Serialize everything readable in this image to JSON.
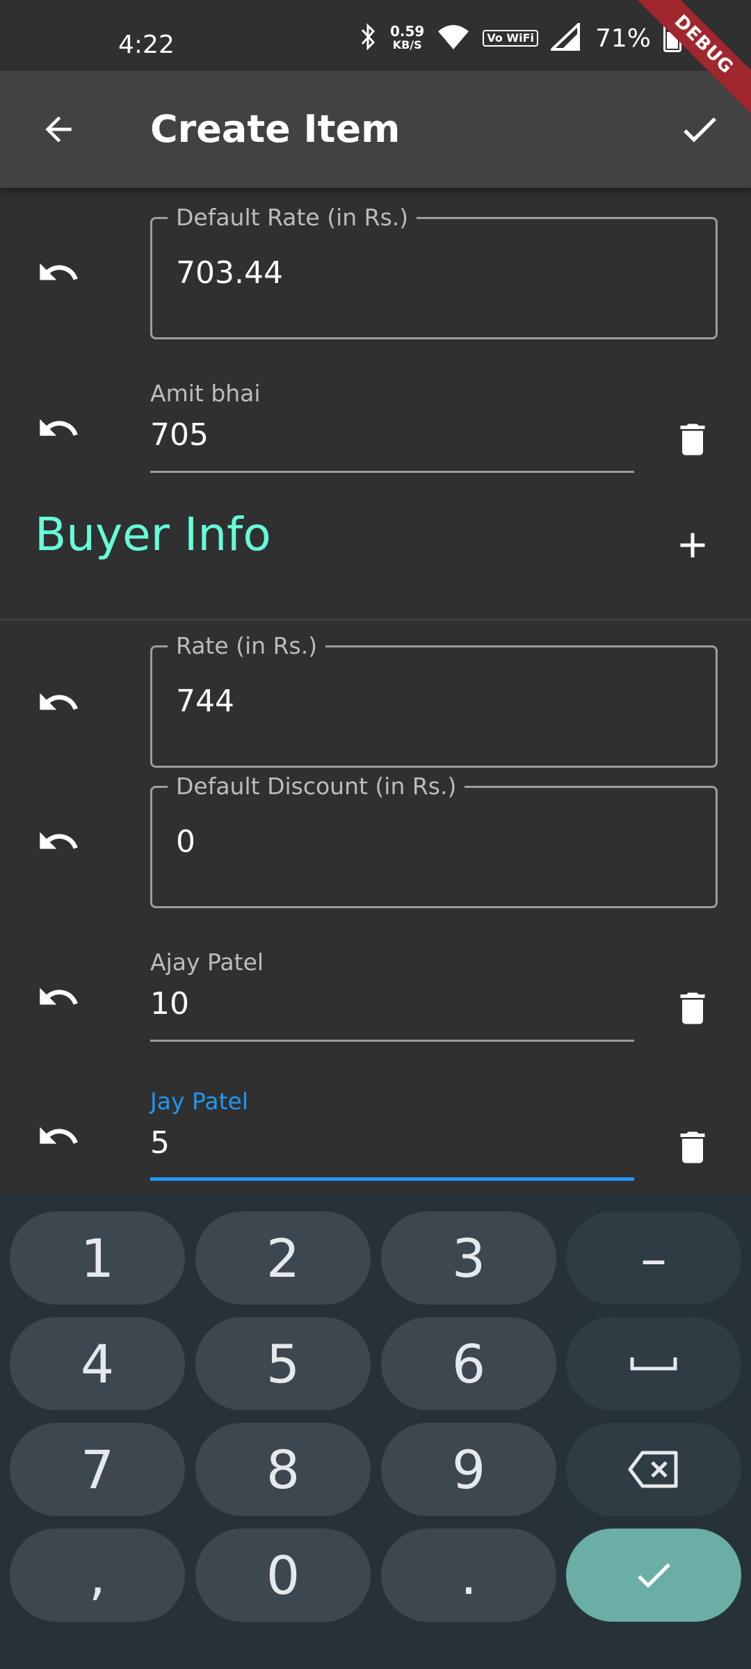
{
  "status_bar": {
    "time": "4:22",
    "net_speed_value": "0.59",
    "net_speed_unit": "KB/S",
    "vowifi": "Vo WiFi",
    "battery_percent": "71%",
    "battery_level": 0.71
  },
  "debug_banner": "DEBUG",
  "app_bar": {
    "title": "Create Item",
    "back_icon": "arrow-left-icon",
    "confirm_icon": "check-icon"
  },
  "seller_section": {
    "default_rate": {
      "label": "Default Rate (in Rs.)",
      "value": "703.44"
    },
    "entries": [
      {
        "name": "Amit bhai",
        "value": "705"
      }
    ]
  },
  "buyer_section": {
    "title": "Buyer Info",
    "add_icon": "plus-icon",
    "rate": {
      "label": "Rate (in Rs.)",
      "value": "744"
    },
    "default_discount": {
      "label": "Default Discount (in Rs.)",
      "value": "0"
    },
    "entries": [
      {
        "name": "Ajay Patel",
        "value": "10",
        "focused": false
      },
      {
        "name": "Jay Patel",
        "value": "5",
        "focused": true
      }
    ]
  },
  "colors": {
    "background": "#303030",
    "app_bar": "#424242",
    "accent_teal": "#64ffda",
    "focus_blue": "#2196f3",
    "keyboard_bg": "#263238",
    "keyboard_key": "#3c474f",
    "keyboard_done": "#6aaea6"
  },
  "keyboard": {
    "rows": [
      [
        "1",
        "2",
        "3",
        "–"
      ],
      [
        "4",
        "5",
        "6",
        "space"
      ],
      [
        "7",
        "8",
        "9",
        "backspace"
      ],
      [
        ",",
        "0",
        ".",
        "done"
      ]
    ],
    "labels": {
      "k1": "1",
      "k2": "2",
      "k3": "3",
      "minus": "–",
      "k4": "4",
      "k5": "5",
      "k6": "6",
      "k7": "7",
      "k8": "8",
      "k9": "9",
      "comma": ",",
      "k0": "0",
      "period": "."
    }
  }
}
